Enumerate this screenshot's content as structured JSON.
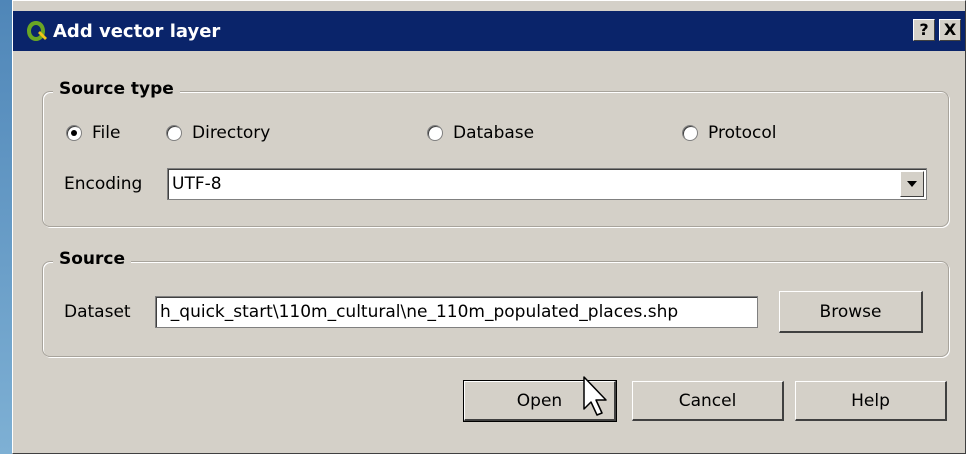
{
  "window": {
    "title": "Add vector layer",
    "help_button": "?",
    "close_button": "X"
  },
  "source_type": {
    "title": "Source type",
    "options": [
      "File",
      "Directory",
      "Database",
      "Protocol"
    ],
    "selected": "File",
    "encoding_label": "Encoding",
    "encoding_value": "UTF-8"
  },
  "source": {
    "title": "Source",
    "dataset_label": "Dataset",
    "dataset_value": "h_quick_start\\110m_cultural\\ne_110m_populated_places.shp",
    "browse_label": "Browse"
  },
  "buttons": {
    "open": "Open",
    "cancel": "Cancel",
    "help": "Help"
  },
  "colors": {
    "titlebar": "#0a246a",
    "dialog_bg": "#d4d0c8",
    "icon_green": "#6aa624"
  },
  "icons": [
    "qgis-logo-icon",
    "help-icon",
    "close-icon",
    "chevron-down-icon",
    "mouse-pointer-icon"
  ]
}
